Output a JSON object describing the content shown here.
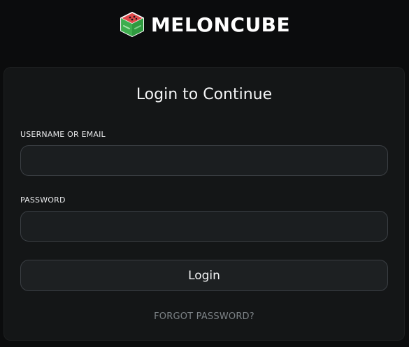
{
  "brand": {
    "name": "MELONCUBE",
    "logo_icon": "melon-cube-icon"
  },
  "login_card": {
    "title": "Login to Continue",
    "username": {
      "label": "USERNAME OR EMAIL",
      "value": "",
      "placeholder": ""
    },
    "password": {
      "label": "PASSWORD",
      "value": "",
      "placeholder": ""
    },
    "login_button": "Login",
    "forgot_password": "FORGOT PASSWORD?"
  },
  "colors": {
    "page_bg": "#0b0c0d",
    "card_bg": "#141617",
    "input_border": "#3b3f44",
    "text_primary": "#f3f4f5",
    "text_muted": "#7d8387",
    "logo_green": "#3fb04f",
    "logo_red": "#e0484a"
  }
}
